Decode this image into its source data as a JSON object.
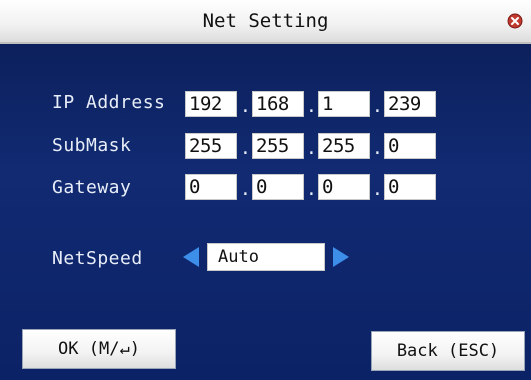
{
  "window": {
    "title": "Net Setting"
  },
  "ip": {
    "label": "IP Address",
    "octets": [
      "192",
      "168",
      "1",
      "239"
    ]
  },
  "mask": {
    "label": "SubMask",
    "octets": [
      "255",
      "255",
      "255",
      "0"
    ]
  },
  "gateway": {
    "label": "Gateway",
    "octets": [
      "0",
      "0",
      "0",
      "0"
    ]
  },
  "separator": ".",
  "netspeed": {
    "label": "NetSpeed",
    "value": "Auto"
  },
  "buttons": {
    "ok_label": "OK (M/↵)",
    "back_label": "Back (ESC)"
  },
  "icons": {
    "close": "close-icon",
    "prev": "arrow-left-icon",
    "next": "arrow-right-icon"
  },
  "colors": {
    "background": "#0a1e55",
    "arrow": "#3d8ee8",
    "close": "#c03a30"
  }
}
